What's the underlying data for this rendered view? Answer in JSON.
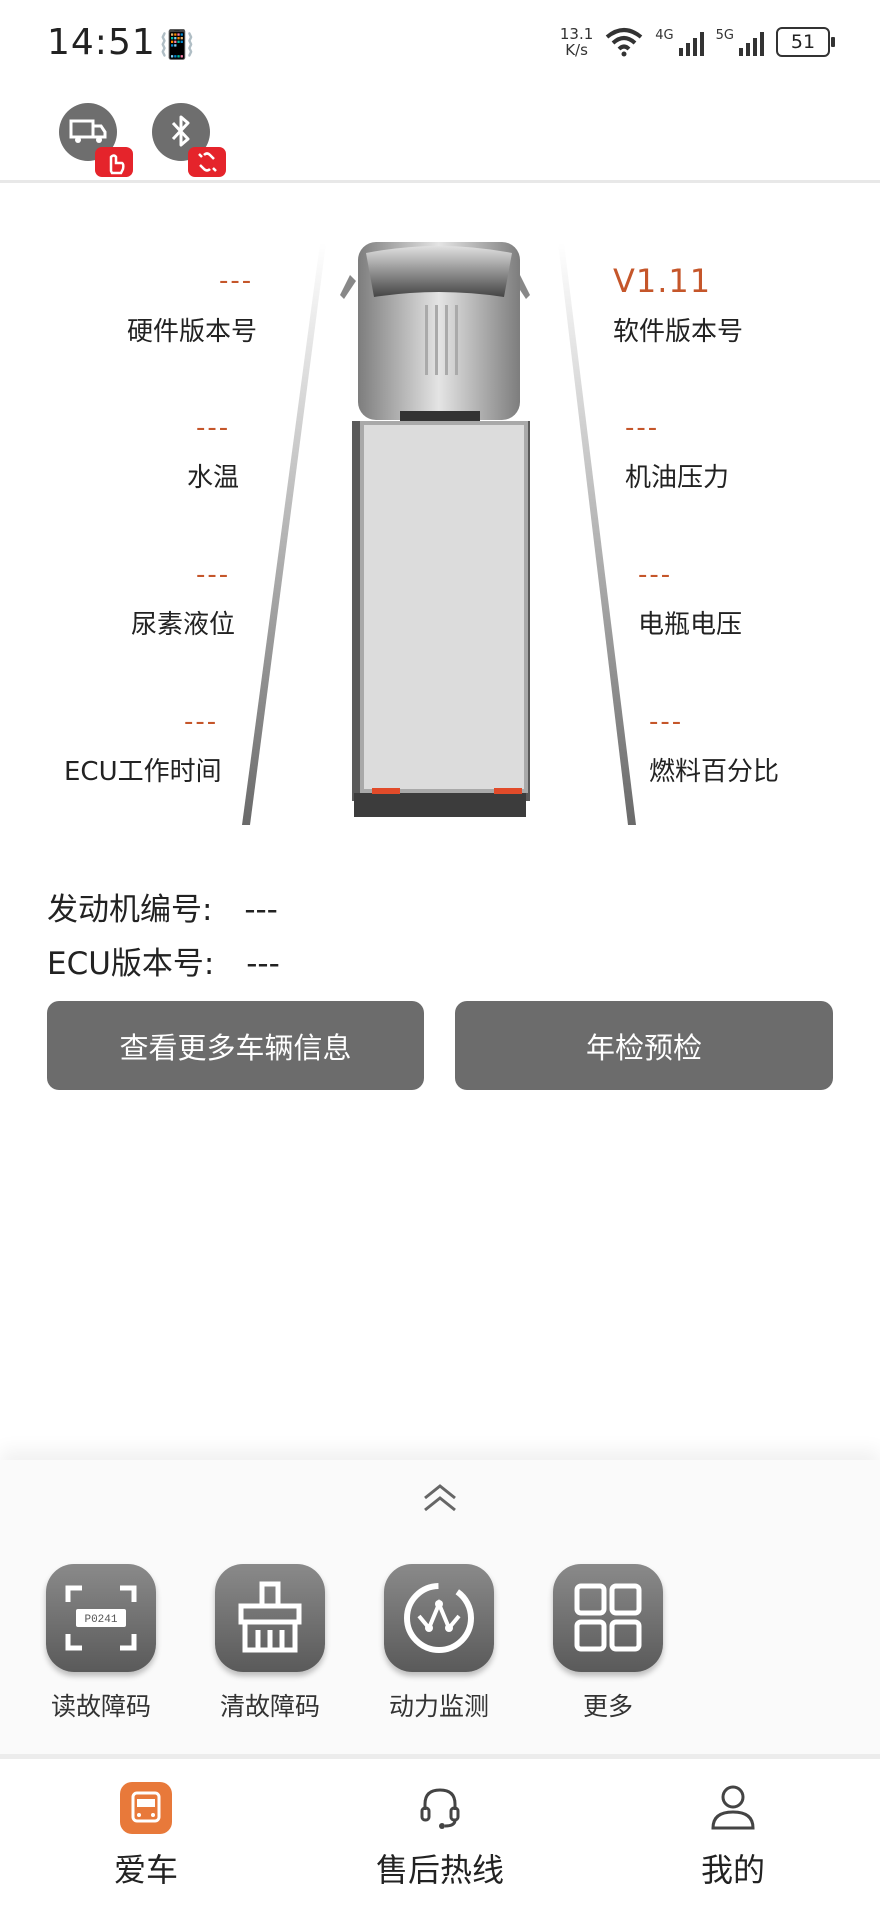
{
  "status_bar": {
    "time": "14:51",
    "net_speed_value": "13.1",
    "net_speed_unit": "K/s",
    "signal_1": "4G",
    "signal_2": "5G",
    "battery": "51"
  },
  "vehicle": {
    "hardware_version": {
      "value": "---",
      "label": "硬件版本号"
    },
    "software_version": {
      "value": "V1.11",
      "label": "软件版本号"
    },
    "water_temp": {
      "value": "---",
      "label": "水温"
    },
    "oil_pressure": {
      "value": "---",
      "label": "机油压力"
    },
    "urea_level": {
      "value": "---",
      "label": "尿素液位"
    },
    "battery_voltage": {
      "value": "---",
      "label": "电瓶电压"
    },
    "ecu_hours": {
      "value": "---",
      "label": "ECU工作时间"
    },
    "fuel_percent": {
      "value": "---",
      "label": "燃料百分比"
    }
  },
  "info": {
    "engine_no_label": "发动机编号:",
    "engine_no_value": "---",
    "ecu_version_label": "ECU版本号:",
    "ecu_version_value": "---"
  },
  "buttons": {
    "more_info": "查看更多车辆信息",
    "inspection": "年检预检"
  },
  "tools": {
    "read_codes": "读故障码",
    "clear_codes": "清故障码",
    "power_monitor": "动力监测",
    "more": "更多",
    "dtc_sample": "P0241"
  },
  "nav": {
    "car": "爱车",
    "hotline": "售后热线",
    "mine": "我的"
  },
  "colors": {
    "accent": "#c5562a",
    "nav_active": "#e8793a",
    "button": "#6c6c6c",
    "badge": "#e5242b"
  }
}
